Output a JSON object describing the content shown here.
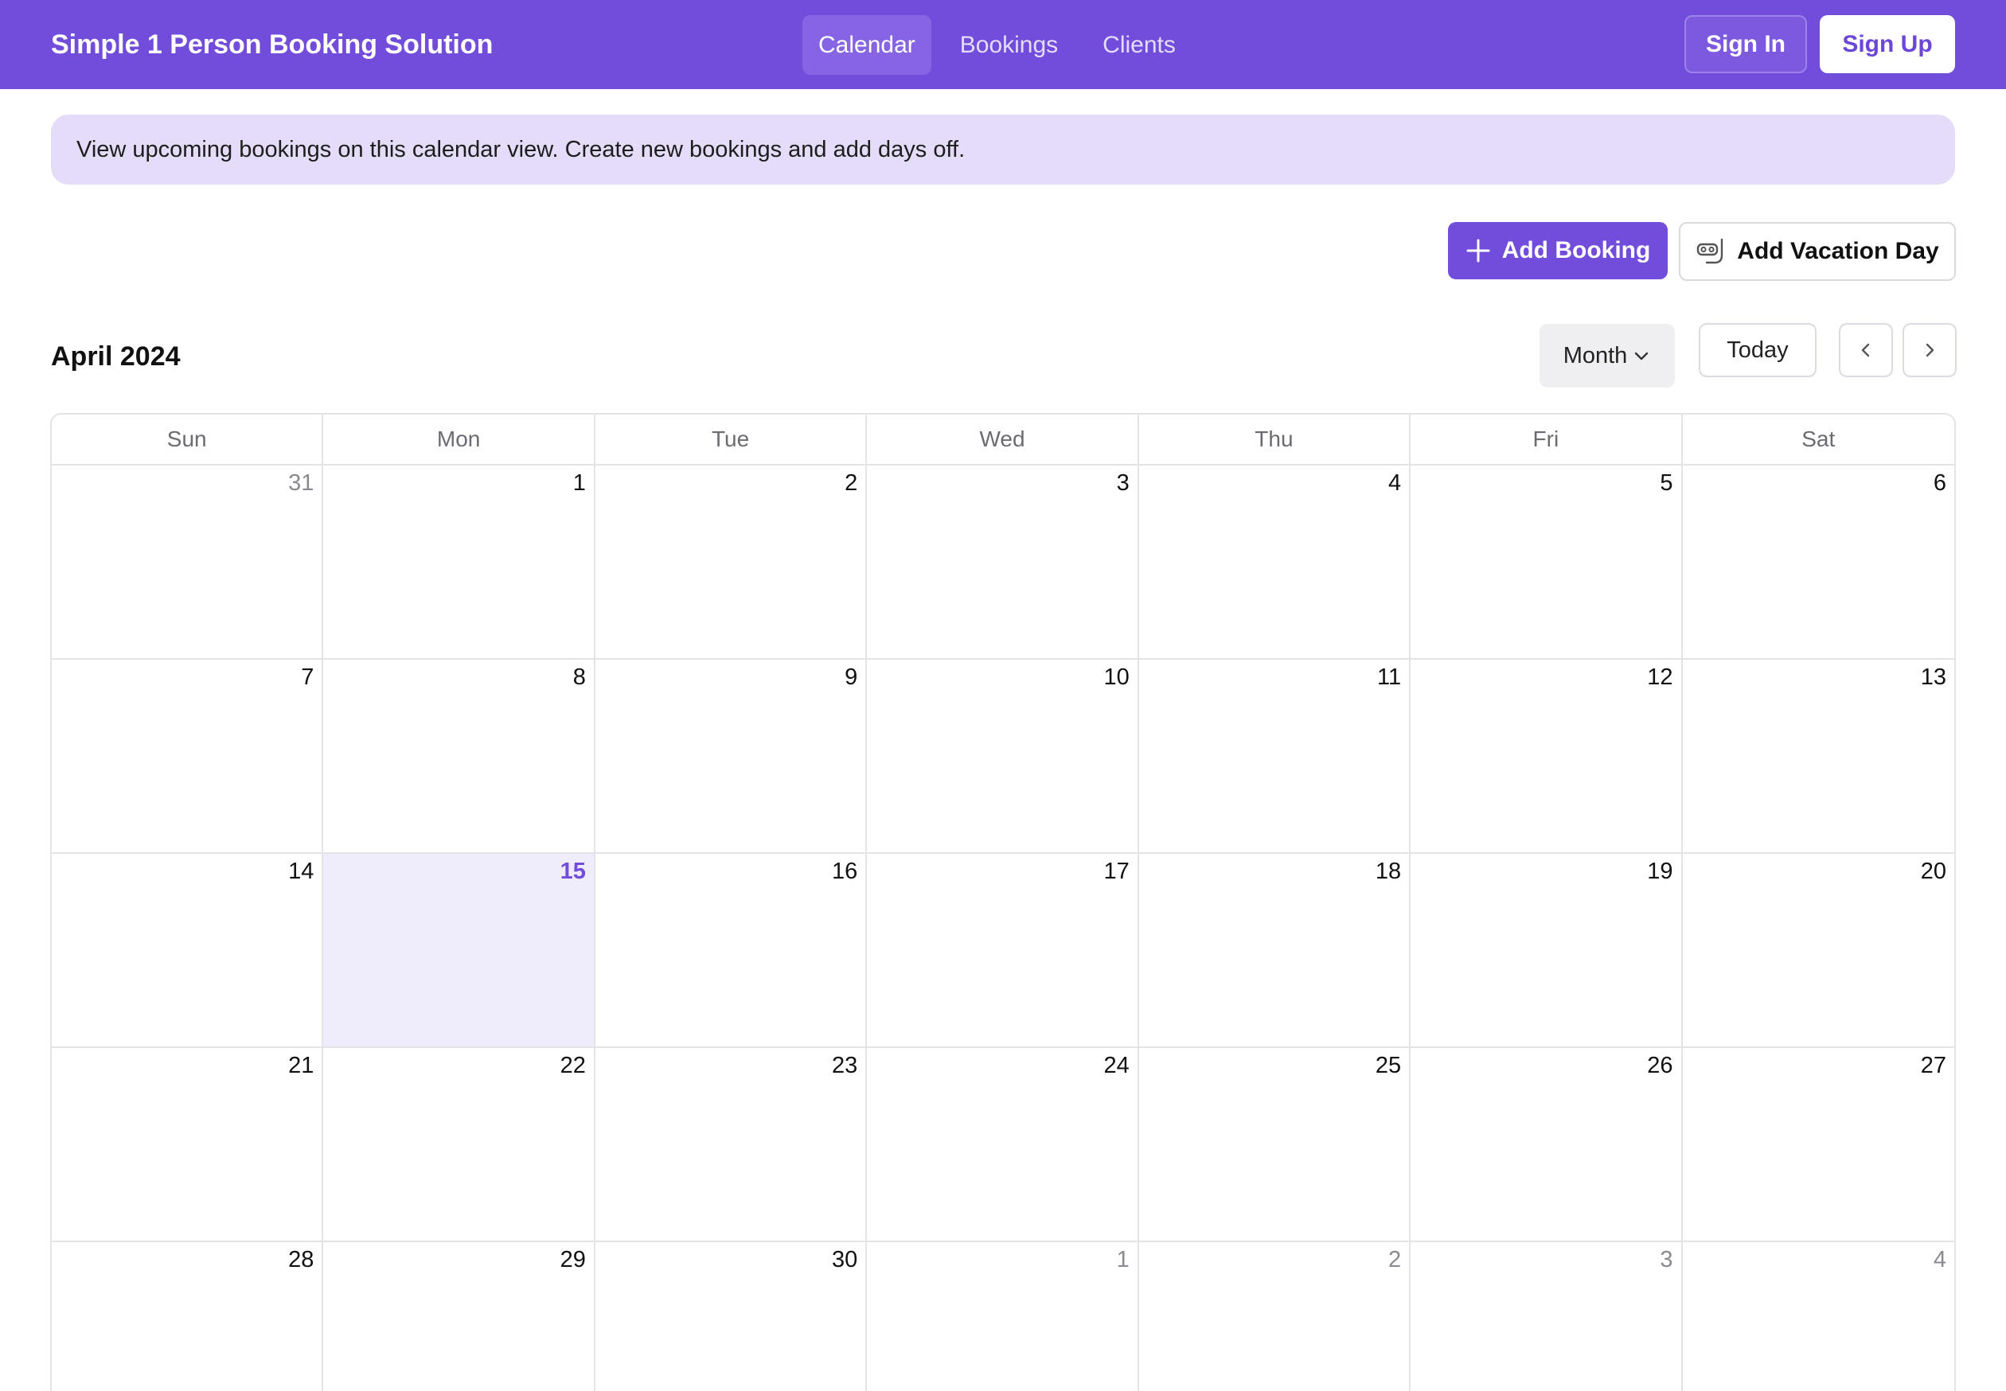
{
  "header": {
    "brand": "Simple 1 Person Booking Solution",
    "nav": [
      {
        "label": "Calendar",
        "active": true
      },
      {
        "label": "Bookings",
        "active": false
      },
      {
        "label": "Clients",
        "active": false
      }
    ],
    "sign_in": "Sign In",
    "sign_up": "Sign Up"
  },
  "banner": {
    "text": "View upcoming bookings on this calendar view. Create new bookings and add days off."
  },
  "actions": {
    "add_booking": "Add Booking",
    "add_vacation": "Add Vacation Day"
  },
  "toolbar": {
    "month_title": "April 2024",
    "view": "Month",
    "today": "Today"
  },
  "calendar": {
    "weekdays": [
      "Sun",
      "Mon",
      "Tue",
      "Wed",
      "Thu",
      "Fri",
      "Sat"
    ],
    "days": [
      {
        "n": "31",
        "outside": true
      },
      {
        "n": "1"
      },
      {
        "n": "2"
      },
      {
        "n": "3"
      },
      {
        "n": "4"
      },
      {
        "n": "5"
      },
      {
        "n": "6"
      },
      {
        "n": "7"
      },
      {
        "n": "8"
      },
      {
        "n": "9"
      },
      {
        "n": "10"
      },
      {
        "n": "11"
      },
      {
        "n": "12"
      },
      {
        "n": "13"
      },
      {
        "n": "14"
      },
      {
        "n": "15",
        "today": true
      },
      {
        "n": "16"
      },
      {
        "n": "17"
      },
      {
        "n": "18"
      },
      {
        "n": "19"
      },
      {
        "n": "20"
      },
      {
        "n": "21"
      },
      {
        "n": "22"
      },
      {
        "n": "23"
      },
      {
        "n": "24"
      },
      {
        "n": "25"
      },
      {
        "n": "26"
      },
      {
        "n": "27"
      },
      {
        "n": "28"
      },
      {
        "n": "29"
      },
      {
        "n": "30"
      },
      {
        "n": "1",
        "outside": true
      },
      {
        "n": "2",
        "outside": true
      },
      {
        "n": "3",
        "outside": true
      },
      {
        "n": "4",
        "outside": true
      }
    ]
  },
  "colors": {
    "primary": "#724ddc",
    "banner_bg": "#e4dcf9",
    "today_bg": "#efecfb"
  },
  "icons": {
    "add_booking": "plus-icon",
    "add_vacation": "snorkel-mask-icon",
    "view_select": "chevron-down-icon",
    "prev": "chevron-left-icon",
    "next": "chevron-right-icon"
  }
}
